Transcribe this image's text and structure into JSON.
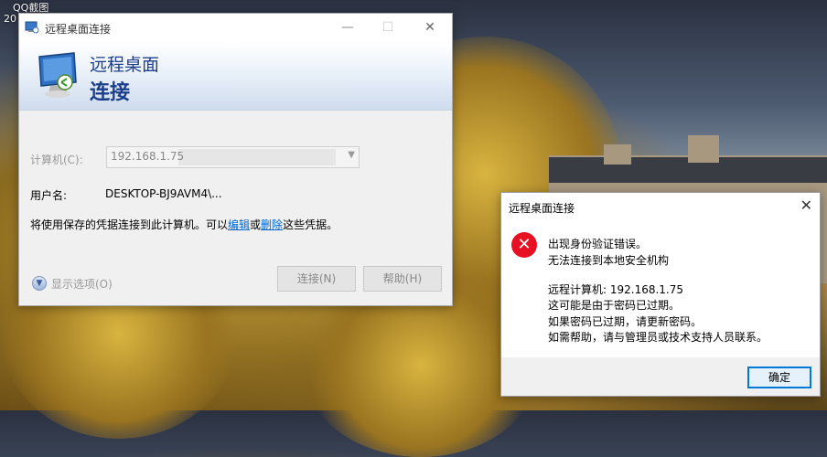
{
  "desktop": {
    "overlay_label": "QQ截图",
    "overlay_label2": "20"
  },
  "rdp": {
    "title": "远程桌面连接",
    "banner_line1": "远程桌面",
    "banner_line2": "连接",
    "computer_label": "计算机(C):",
    "computer_value": "192.168.1.75",
    "username_label": "用户名:",
    "username_value": "DESKTOP-BJ9AVM4\\...",
    "info_prefix": "将使用保存的凭据连接到此计算机。可以",
    "info_edit": "编辑",
    "info_or": "或",
    "info_delete": "删除",
    "info_suffix": "这些凭据。",
    "show_options": "显示选项(O)",
    "connect_button": "连接(N)",
    "help_button": "帮助(H)",
    "minimize_icon": "—",
    "maximize_icon": "☐",
    "close_icon": "✕"
  },
  "error_dialog": {
    "title": "远程桌面连接",
    "close_icon": "✕",
    "icon_glyph": "✕",
    "line1": "出现身份验证错误。",
    "line2": "无法连接到本地安全机构",
    "line3": "远程计算机: 192.168.1.75",
    "line4": "这可能是由于密码已过期。",
    "line5": "如果密码已过期，请更新密码。",
    "line6": "如需帮助，请与管理员或技术支持人员联系。",
    "ok_button": "确定"
  },
  "colors": {
    "accent_blue": "#1b3f8c",
    "link_blue": "#0066cc",
    "error_red": "#e81123",
    "focus_blue": "#0078d7"
  }
}
